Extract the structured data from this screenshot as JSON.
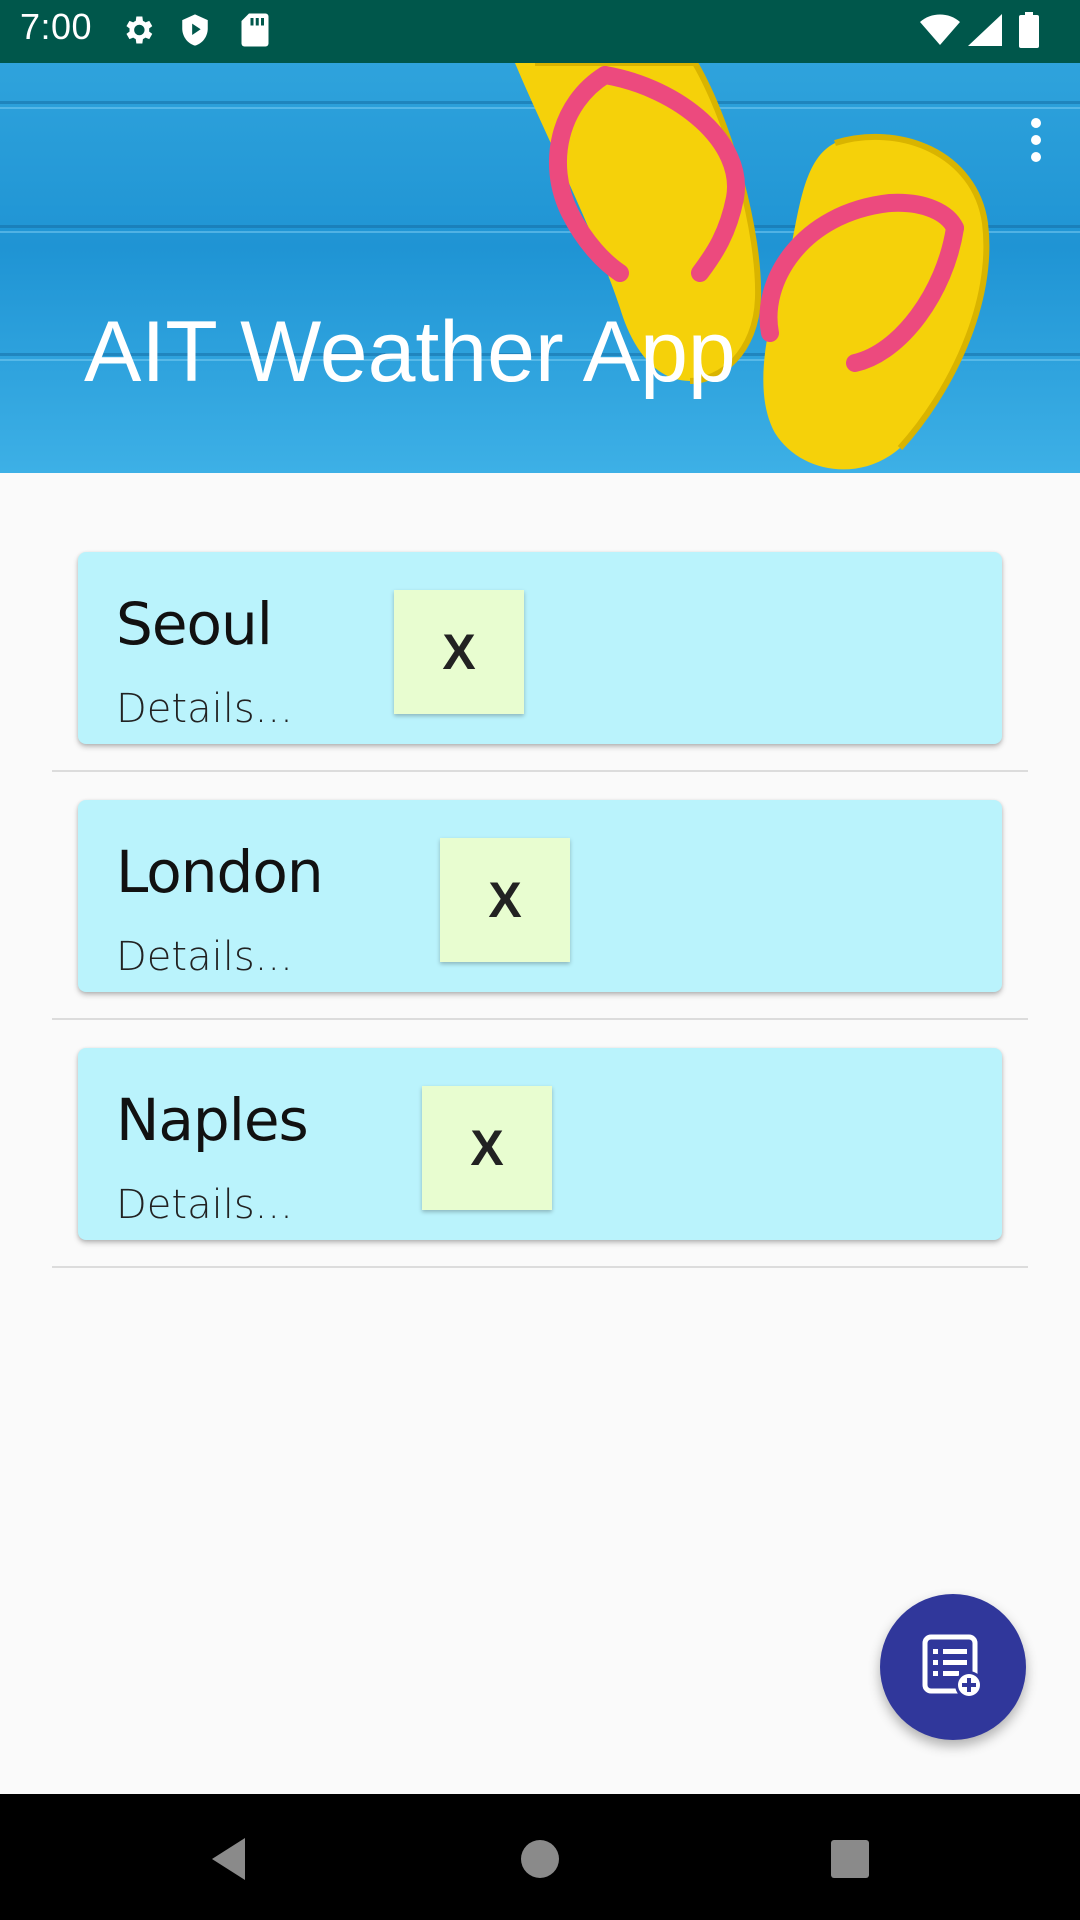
{
  "status_bar": {
    "time": "7:00",
    "left_icons": [
      "gear-icon",
      "play-shield-icon",
      "sd-card-icon"
    ],
    "right_icons": [
      "wifi-icon",
      "cell-signal-icon",
      "battery-icon"
    ]
  },
  "app_bar": {
    "title": "AIT Weather App",
    "overflow_icon": "more-vert-icon"
  },
  "cities": [
    {
      "name": "Seoul",
      "details": "Details...",
      "delete_label": "X"
    },
    {
      "name": "London",
      "details": "Details...",
      "delete_label": "X"
    },
    {
      "name": "Naples",
      "details": "Details...",
      "delete_label": "X"
    }
  ],
  "fab": {
    "icon": "add-to-list-icon"
  },
  "nav_bar": {
    "icons": [
      "back-icon",
      "home-icon",
      "recents-icon"
    ]
  },
  "colors": {
    "status_bar": "#00574B",
    "card": "#BAF3FC",
    "delete_button": "#E8FDD0",
    "fab": "#30379B",
    "background": "#FAFAFA"
  }
}
